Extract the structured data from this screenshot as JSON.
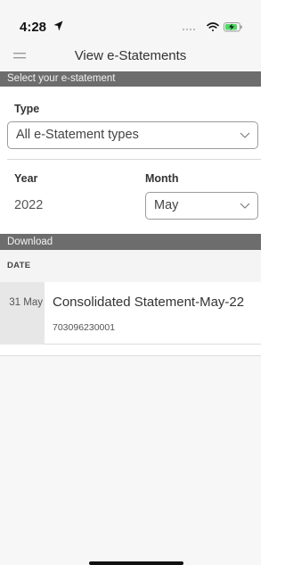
{
  "status_bar": {
    "time": "4:28",
    "icons": [
      "location-arrow-icon",
      "signal-dots-icon",
      "wifi-icon",
      "battery-charging-icon"
    ]
  },
  "nav": {
    "title": "View e-Statements",
    "menu_icon": "hamburger-menu-icon"
  },
  "select_section": {
    "header": "Select your e-statement",
    "type_label": "Type",
    "type_value": "All e-Statement types",
    "year_label": "Year",
    "year_value": "2022",
    "month_label": "Month",
    "month_value": "May"
  },
  "download": {
    "header": "Download",
    "columns": [
      "DATE"
    ],
    "rows": [
      {
        "date": "31 May",
        "title": "Consolidated Statement-May-22",
        "reference": "703096230001"
      }
    ]
  },
  "colors": {
    "section_header_bg": "#6d6d6d",
    "bar_bg": "#f6f6f6",
    "date_cell_bg": "#e7e7e7"
  }
}
